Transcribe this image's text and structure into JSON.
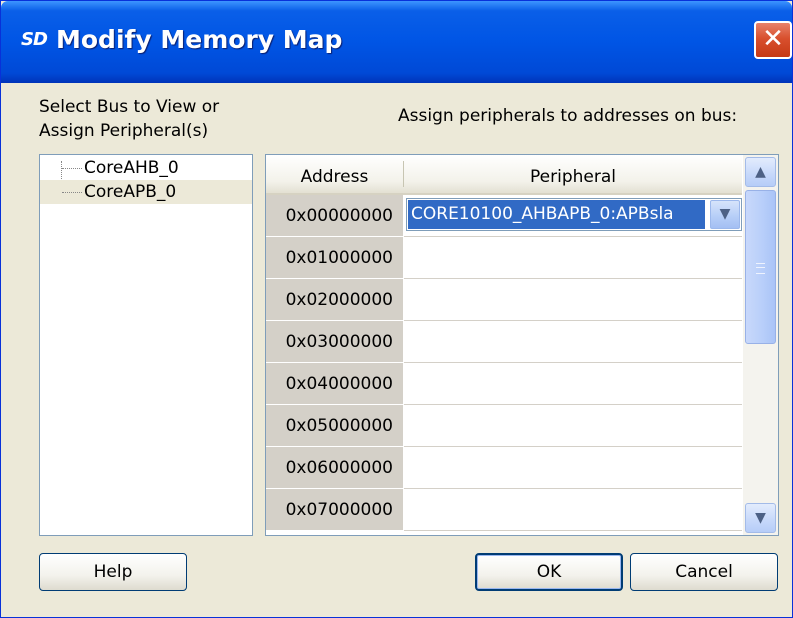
{
  "window": {
    "app_icon_text": "SD",
    "title": "Modify Memory Map",
    "close_glyph": "✕"
  },
  "left_panel": {
    "label_line1": "Select Bus to View or",
    "label_line2": "Assign Peripheral(s)",
    "tree_items": [
      {
        "label": "CoreAHB_0",
        "selected": false
      },
      {
        "label": "CoreAPB_0",
        "selected": true
      }
    ]
  },
  "right_panel": {
    "label": "Assign peripherals to addresses on bus:",
    "columns": [
      "Address",
      "Peripheral"
    ],
    "rows": [
      {
        "address": "0x00000000",
        "peripheral": "CORE10100_AHBAPB_0:APBsla"
      },
      {
        "address": "0x01000000",
        "peripheral": ""
      },
      {
        "address": "0x02000000",
        "peripheral": ""
      },
      {
        "address": "0x03000000",
        "peripheral": ""
      },
      {
        "address": "0x04000000",
        "peripheral": ""
      },
      {
        "address": "0x05000000",
        "peripheral": ""
      },
      {
        "address": "0x06000000",
        "peripheral": ""
      },
      {
        "address": "0x07000000",
        "peripheral": ""
      }
    ],
    "combo_icon": "chevron-down-icon",
    "scroll_up_icon": "chevron-up-icon",
    "scroll_down_icon": "chevron-down-icon"
  },
  "buttons": {
    "help": "Help",
    "ok": "OK",
    "cancel": "Cancel"
  },
  "colors": {
    "titlebar": "#0055e5",
    "window_bg": "#ECE9D8",
    "selection": "#316ac5",
    "close_button": "#d8502e"
  }
}
